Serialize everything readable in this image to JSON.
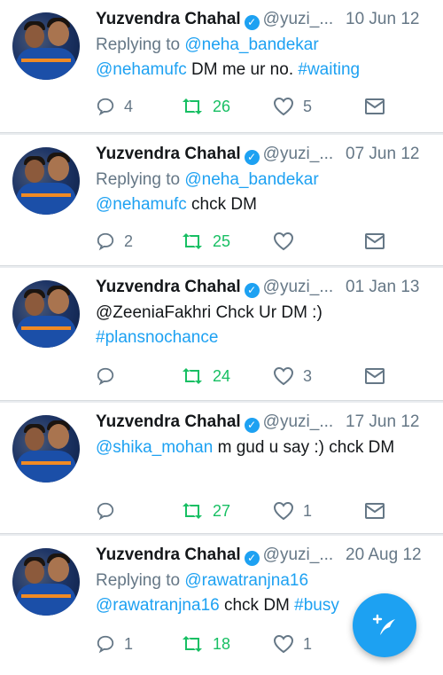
{
  "tweets": [
    {
      "name": "Yuzvendra Chahal",
      "handle": "@yuzi_...",
      "date": "10 Jun 12",
      "reply_prefix": "Replying to ",
      "reply_to": "@neha_bandekar",
      "mention": "@nehamufc",
      "text": " DM me ur no. ",
      "hashtag": "#waiting",
      "replies": "4",
      "retweets": "26",
      "likes": "5"
    },
    {
      "name": "Yuzvendra Chahal",
      "handle": "@yuzi_...",
      "date": "07 Jun 12",
      "reply_prefix": "Replying to ",
      "reply_to": "@neha_bandekar",
      "mention": "@nehamufc",
      "text": " chck DM",
      "replies": "2",
      "retweets": "25",
      "likes": ""
    },
    {
      "name": "Yuzvendra Chahal",
      "handle": "@yuzi_...",
      "date": "01 Jan 13",
      "text": "@ZeeniaFakhri Chck Ur DM :)",
      "hashtag": "#plansnochance",
      "replies": "",
      "retweets": "24",
      "likes": "3"
    },
    {
      "name": "Yuzvendra Chahal",
      "handle": "@yuzi_...",
      "date": "17 Jun 12",
      "mention": "@shika_mohan",
      "text": " m gud u say :) chck DM",
      "replies": "",
      "retweets": "27",
      "likes": "1"
    },
    {
      "name": "Yuzvendra Chahal",
      "handle": "@yuzi_...",
      "date": "20 Aug 12",
      "reply_prefix": "Replying to ",
      "reply_to": "@rawatranjna16",
      "mention": "@rawatranjna16",
      "text": " chck DM ",
      "hashtag": "#busy",
      "replies": "1",
      "retweets": "18",
      "likes": "1"
    }
  ],
  "icons": {
    "reply": "reply-icon",
    "retweet": "retweet-icon",
    "like": "heart-icon",
    "dm": "envelope-icon",
    "verified": "verified-badge-icon",
    "compose": "compose-tweet-icon"
  },
  "colors": {
    "link": "#1da1f2",
    "retweet": "#17bf63",
    "muted": "#657786",
    "fab": "#1da1f2"
  }
}
